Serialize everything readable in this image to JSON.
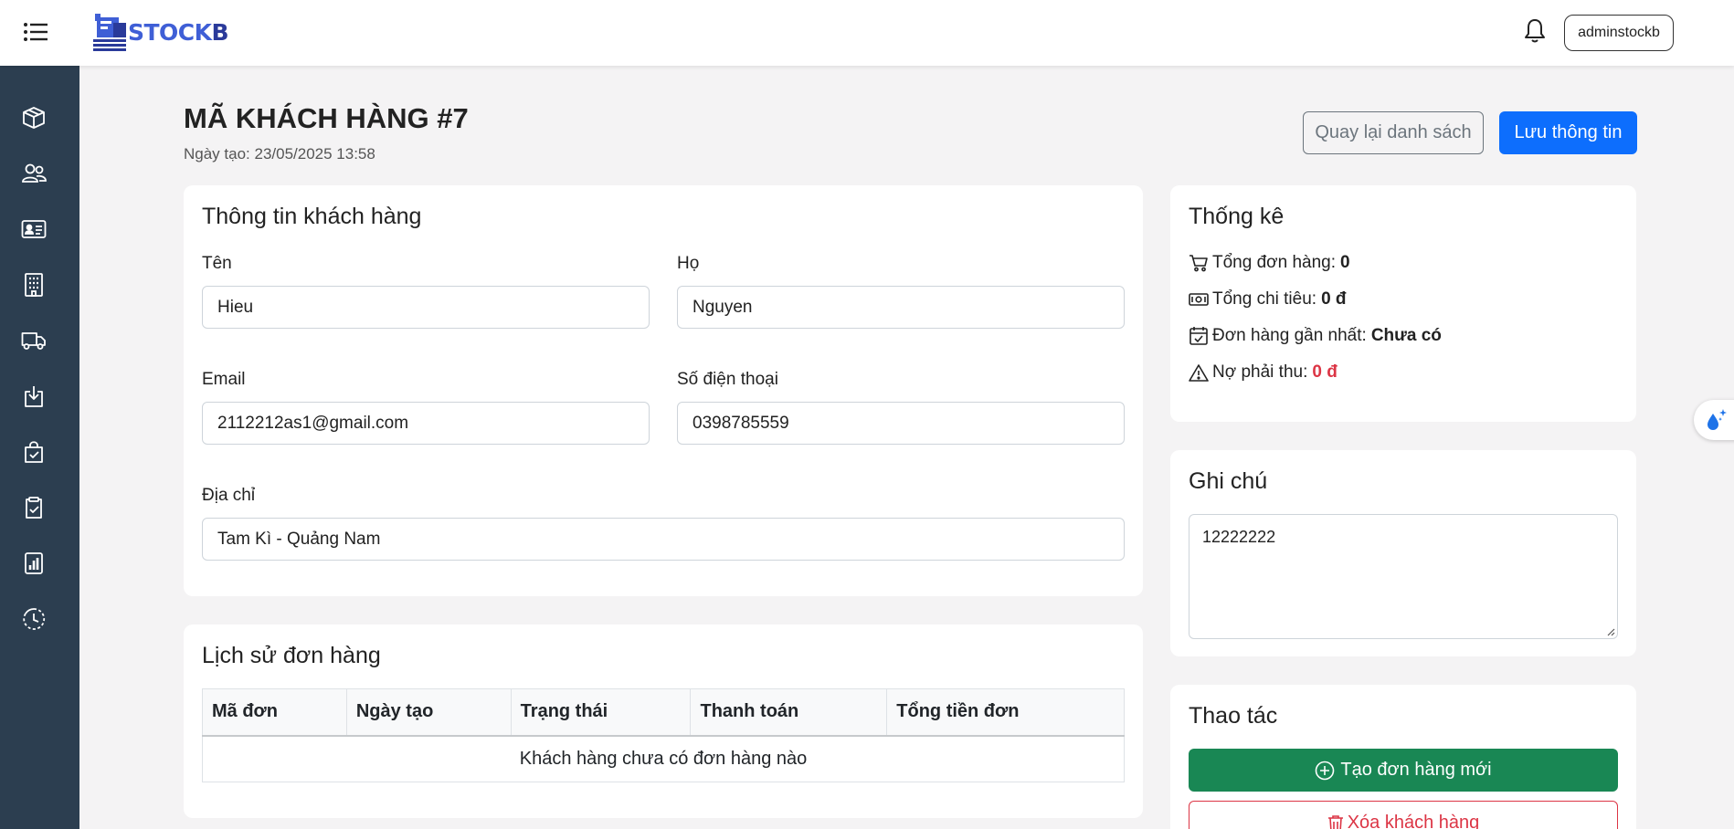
{
  "header": {
    "logo_text_main": "STOCK",
    "logo_text_end": "B",
    "user_label": "adminstockb"
  },
  "sidebar": {
    "items": [
      {
        "icon": "box-icon"
      },
      {
        "icon": "people-icon"
      },
      {
        "icon": "id-card-icon"
      },
      {
        "icon": "building-icon"
      },
      {
        "icon": "truck-icon"
      },
      {
        "icon": "download-box-icon"
      },
      {
        "icon": "bag-check-icon"
      },
      {
        "icon": "clipboard-check-icon"
      },
      {
        "icon": "report-chart-icon"
      },
      {
        "icon": "clock-history-icon"
      }
    ]
  },
  "page": {
    "title": "MÃ KHÁCH HÀNG #7",
    "created": "Ngày tạo: 23/05/2025 13:58",
    "back_button": "Quay lại danh sách",
    "save_button": "Lưu thông tin"
  },
  "customer_info": {
    "title": "Thông tin khách hàng",
    "first_name_label": "Tên",
    "first_name_value": "Hieu",
    "last_name_label": "Họ",
    "last_name_value": "Nguyen",
    "email_label": "Email",
    "email_value": "2112212as1@gmail.com",
    "phone_label": "Số điện thoại",
    "phone_value": "0398785559",
    "address_label": "Địa chỉ",
    "address_value": "Tam Kì - Quảng Nam"
  },
  "stats": {
    "title": "Thống kê",
    "total_orders_label": "Tổng đơn hàng:",
    "total_orders_value": "0",
    "total_spent_label": "Tổng chi tiêu:",
    "total_spent_value": "0 đ",
    "latest_order_label": "Đơn hàng gần nhất:",
    "latest_order_value": "Chưa có",
    "debt_label": "Nợ phải thu:",
    "debt_value": "0 đ"
  },
  "notes": {
    "title": "Ghi chú",
    "value": "12222222"
  },
  "order_history": {
    "title": "Lịch sử đơn hàng",
    "columns": [
      "Mã đơn",
      "Ngày tạo",
      "Trạng thái",
      "Thanh toán",
      "Tổng tiền đơn"
    ],
    "empty_text": "Khách hàng chưa có đơn hàng nào"
  },
  "actions": {
    "title": "Thao tác",
    "create_order": "Tạo đơn hàng mới",
    "delete_customer": "Xóa khách hàng"
  },
  "colors": {
    "primary": "#0d6efd",
    "success": "#198754",
    "danger": "#dc3545",
    "sidebar": "#2c3e50",
    "brand": "#3f5fd6"
  }
}
